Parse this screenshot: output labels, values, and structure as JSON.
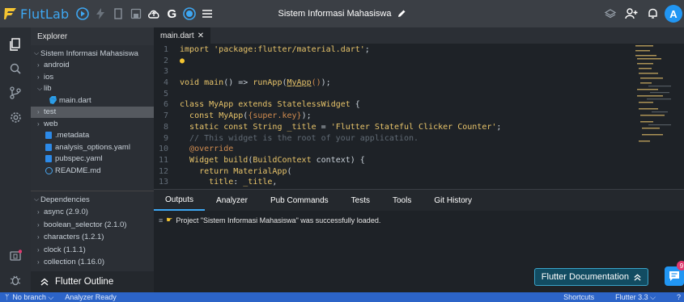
{
  "app": {
    "name": "FlutLab",
    "project_title": "Sistem Informasi Mahasiswa",
    "avatar_letter": "A"
  },
  "explorer": {
    "header": "Explorer",
    "root": "Sistem Informasi Mahasiswa",
    "items": [
      {
        "label": "android",
        "type": "folder"
      },
      {
        "label": "ios",
        "type": "folder"
      },
      {
        "label": "lib",
        "type": "folder-open"
      },
      {
        "label": "main.dart",
        "type": "dart"
      },
      {
        "label": "test",
        "type": "folder-selected"
      },
      {
        "label": "web",
        "type": "folder"
      },
      {
        "label": ".metadata",
        "type": "file"
      },
      {
        "label": "analysis_options.yaml",
        "type": "file"
      },
      {
        "label": "pubspec.yaml",
        "type": "file"
      },
      {
        "label": "README.md",
        "type": "info"
      }
    ]
  },
  "dependencies": {
    "header": "Dependencies",
    "items": [
      "async (2.9.0)",
      "boolean_selector (2.1.0)",
      "characters (1.2.1)",
      "clock (1.1.1)",
      "collection (1.16.0)"
    ]
  },
  "outline": {
    "label": "Flutter Outline"
  },
  "editor": {
    "tab": "main.dart",
    "line_numbers": [
      "1",
      "2",
      "3",
      "4",
      "5",
      "6",
      "7",
      "8",
      "9",
      "10",
      "11",
      "12",
      "13"
    ]
  },
  "panel": {
    "tabs": [
      "Outputs",
      "Analyzer",
      "Pub Commands",
      "Tests",
      "Tools",
      "Git History"
    ],
    "log": "Project \"Sistem Informasi Mahasiswa\" was successfully loaded.",
    "docs_button": "Flutter Documentation",
    "badge": "9"
  },
  "status": {
    "branch": "No branch",
    "analyzer": "Analyzer Ready",
    "shortcuts": "Shortcuts",
    "version": "Flutter 3.3"
  },
  "colors": {
    "accent": "#3ea7f2",
    "statusbar": "#2c64c8",
    "keyword": "#e8c46a",
    "comment": "#616b75"
  }
}
